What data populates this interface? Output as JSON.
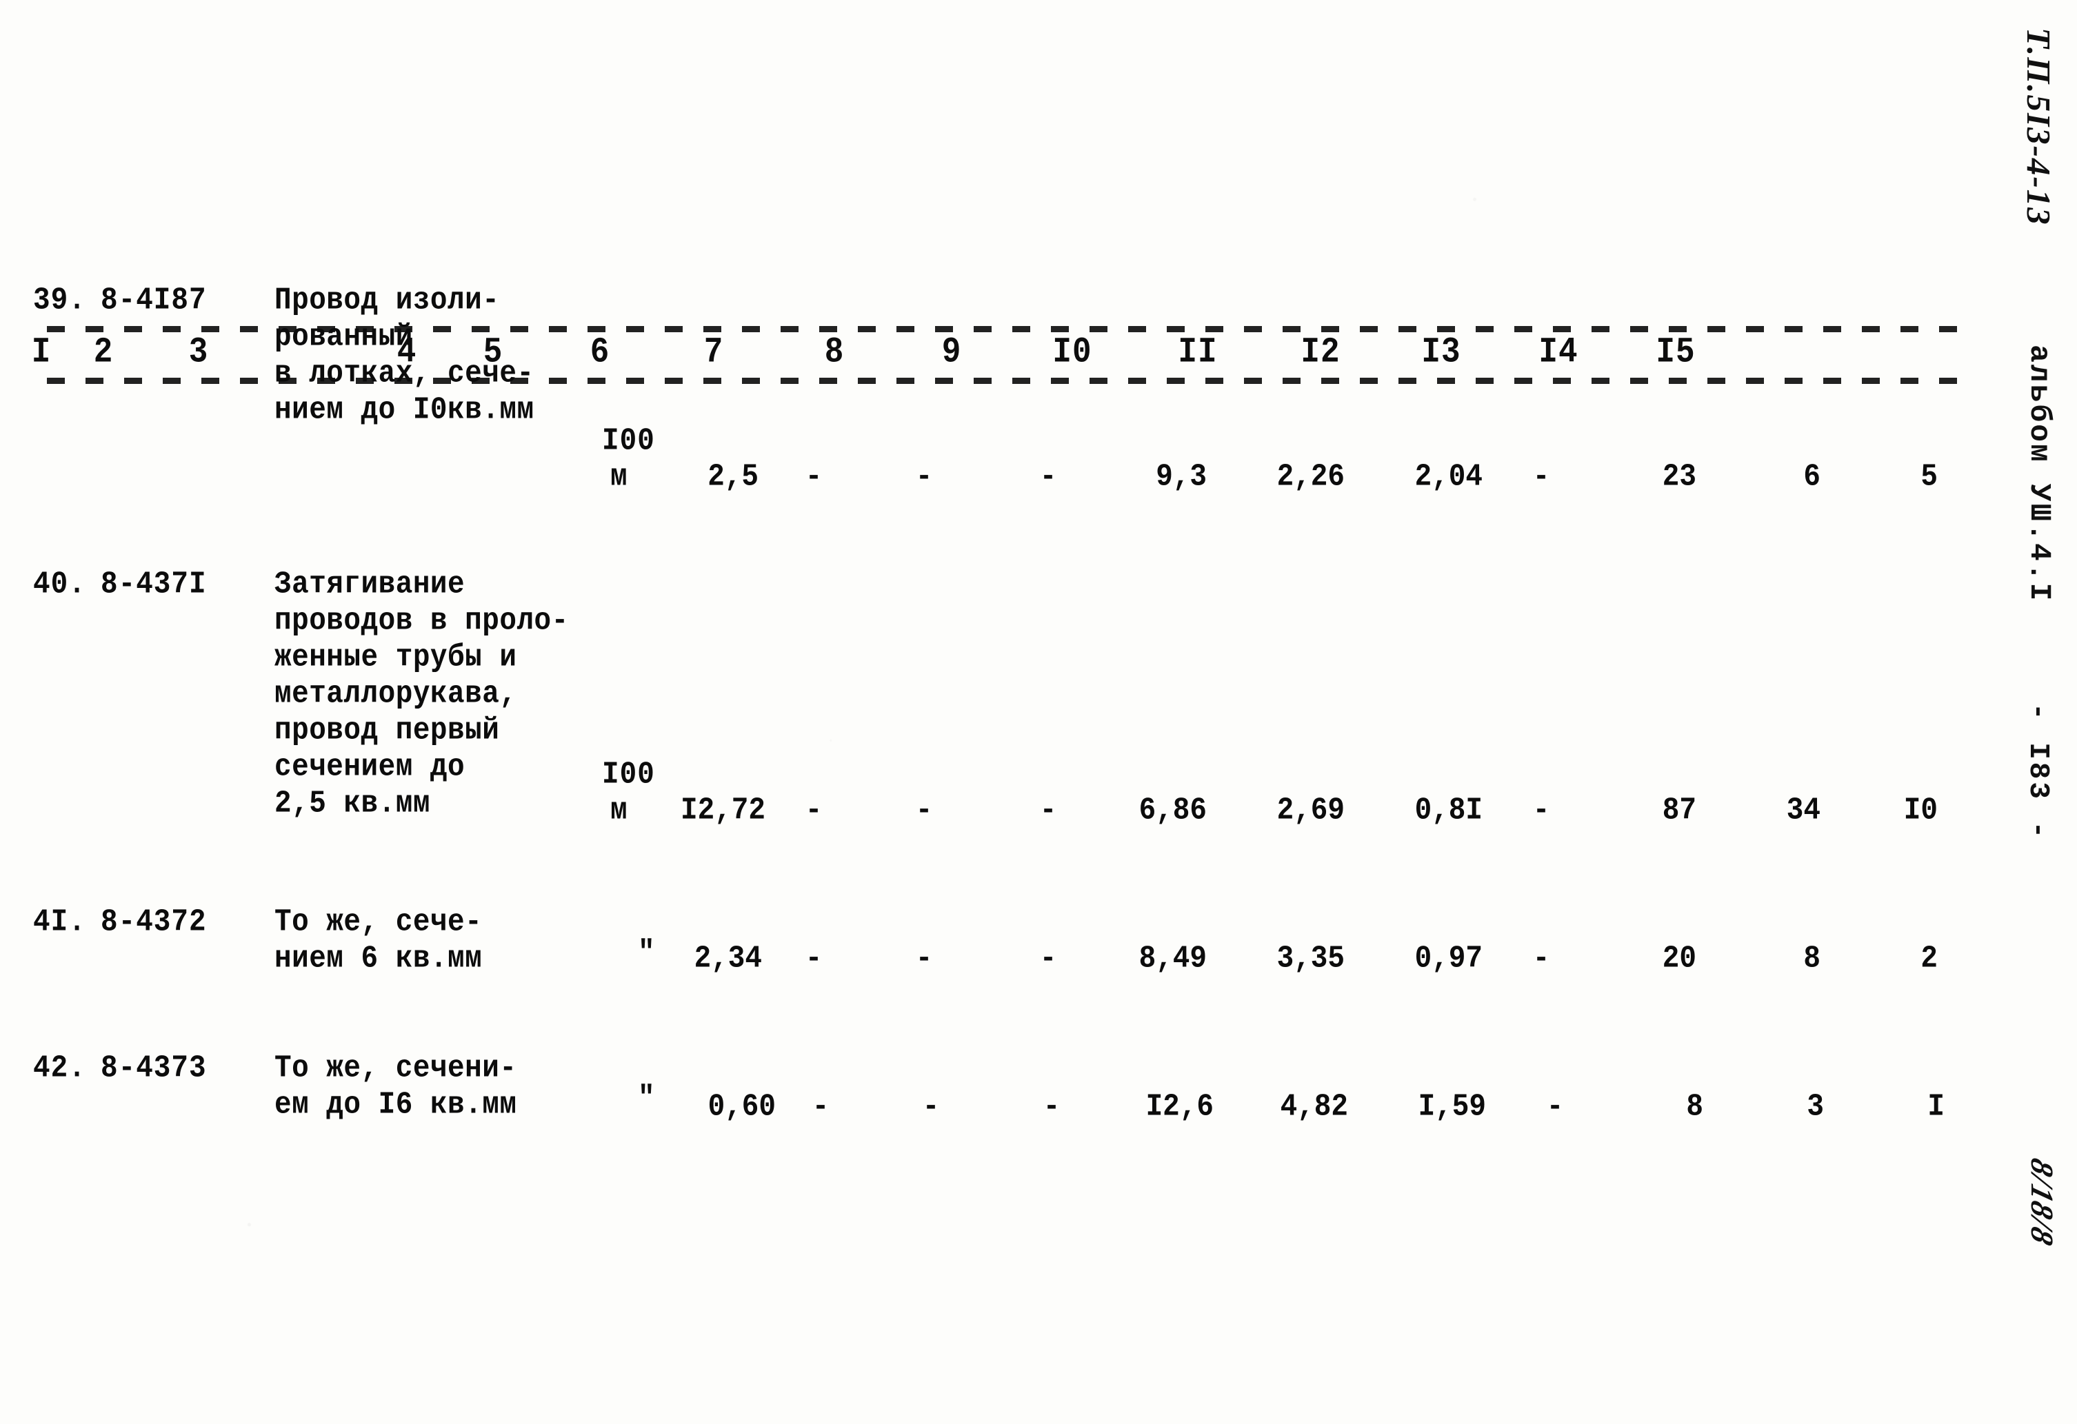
{
  "document": {
    "type": "scanned-typewritten-table",
    "language": "ru",
    "ink_color": "#0c0c0c",
    "paper_color": "#fdfdfb"
  },
  "table": {
    "column_headers": [
      "I",
      "2",
      "3",
      "4",
      "5",
      "6",
      "7",
      "8",
      "9",
      "I0",
      "II",
      "I2",
      "I3",
      "I4",
      "I5"
    ],
    "rows": [
      {
        "index": "39.",
        "code": "8-4I87",
        "description": [
          "Провод изоли-",
          "рованный",
          "в лотках, сече-",
          "нием до I0кв.мм"
        ],
        "unit": [
          "I00",
          "м"
        ],
        "values": [
          "2,5",
          "-",
          "-",
          "-",
          "9,3",
          "2,26",
          "2,04",
          "-",
          "23",
          "6",
          "5"
        ]
      },
      {
        "index": "40.",
        "code": "8-437I",
        "description": [
          "Затягивание",
          "проводов в проло-",
          "женные трубы и",
          "металлорукава,",
          "провод первый",
          "сечением до",
          "2,5 кв.мм"
        ],
        "unit": [
          "I00",
          "м"
        ],
        "values": [
          "I2,72",
          "-",
          "-",
          "-",
          "6,86",
          "2,69",
          "0,8I",
          "-",
          "87",
          "34",
          "I0"
        ]
      },
      {
        "index": "4I.",
        "code": "8-4372",
        "description": [
          "То же, сече-",
          "нием 6 кв.мм"
        ],
        "unit": [
          "",
          "\""
        ],
        "values": [
          "2,34",
          "-",
          "-",
          "-",
          "8,49",
          "3,35",
          "0,97",
          "-",
          "20",
          "8",
          "2"
        ]
      },
      {
        "index": "42.",
        "code": "8-4373",
        "description": [
          "То же, сечени-",
          "ем до I6 кв.мм"
        ],
        "unit": [
          "",
          "\""
        ],
        "values": [
          "0,60",
          "-",
          "-",
          "-",
          "I2,6",
          "4,82",
          "I,59",
          "-",
          "8",
          "3",
          "I"
        ]
      }
    ]
  },
  "margin_marks": {
    "drawing_number": "Т.П.5I3-4-13",
    "album": "альбом УШ.4.I",
    "page_number": "- I83 -",
    "handwritten_note": "8/18/8"
  }
}
